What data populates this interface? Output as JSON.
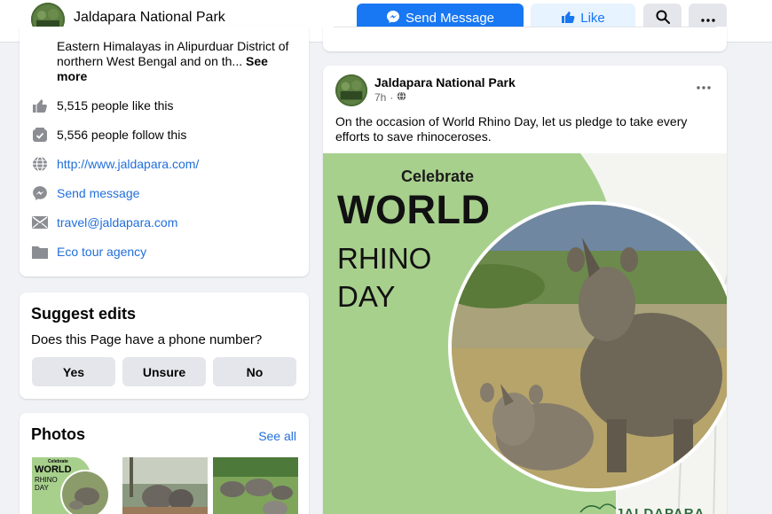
{
  "header": {
    "page_name": "Jaldapara National Park",
    "send_message": "Send Message",
    "like": "Like"
  },
  "about": {
    "description": "Eastern Himalayas in Alipurduar District of northern West Bengal and on th...",
    "see_more": "See more",
    "likes": "5,515 people like this",
    "follows": "5,556 people follow this",
    "website": "http://www.jaldapara.com/",
    "send_message": "Send message",
    "email": "travel@jaldapara.com",
    "category": "Eco tour agency"
  },
  "suggest": {
    "title": "Suggest edits",
    "question": "Does this Page have a phone number?",
    "yes": "Yes",
    "unsure": "Unsure",
    "no": "No"
  },
  "photos": {
    "title": "Photos",
    "see_all": "See all",
    "thumb_text": {
      "celebrate": "Celebrate",
      "world": "WORLD",
      "rhino": "RHINO",
      "day": "DAY"
    }
  },
  "post": {
    "author": "Jaldapara National Park",
    "time": "7h",
    "text": "On the occasion of World Rhino Day, let us pledge to take every efforts to save rhinoceroses.",
    "image_text": {
      "celebrate": "Celebrate",
      "world": "WORLD",
      "rhino": "RHINO",
      "day": "DAY",
      "brand": "JALDAPARA"
    }
  },
  "colors": {
    "primary": "#1877f2",
    "link": "#216fdb",
    "secondary_btn": "#e4e6eb",
    "green_panel": "#a8d08d"
  },
  "icons": [
    "messenger-icon",
    "like-icon",
    "search-icon",
    "more-icon",
    "thumbs-up-icon",
    "follow-icon",
    "globe-icon",
    "messenger-icon",
    "mail-icon",
    "category-icon",
    "globe-icon"
  ]
}
